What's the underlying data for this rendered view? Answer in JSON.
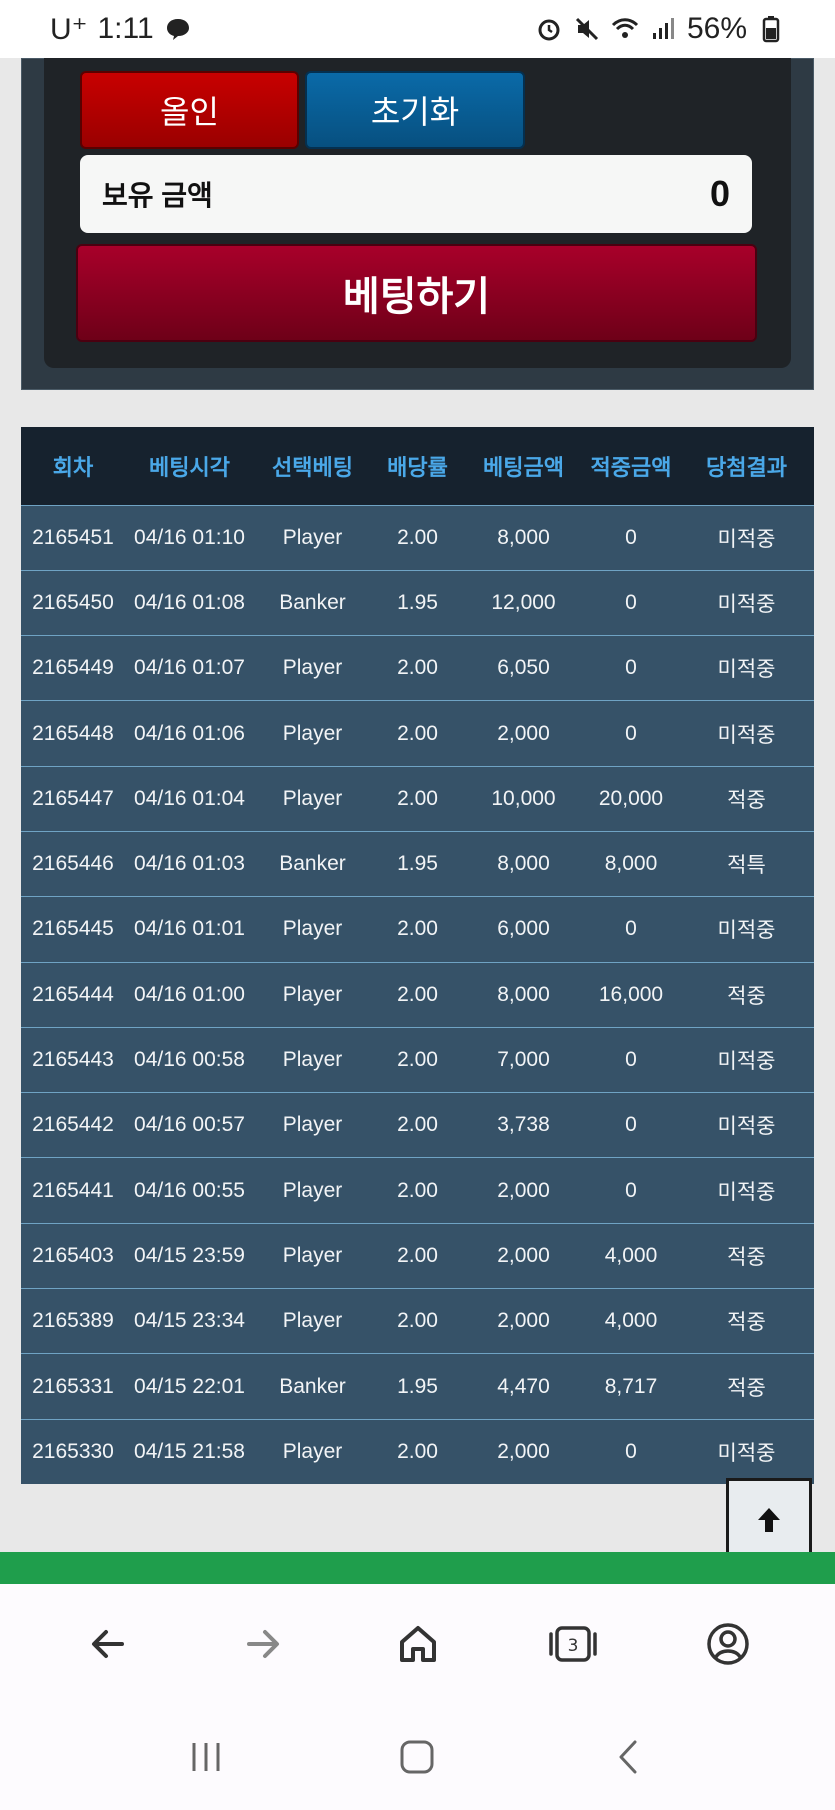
{
  "status_bar": {
    "carrier": "U⁺",
    "time": "1:11",
    "battery": "56%"
  },
  "controls": {
    "allin_label": "올인",
    "reset_label": "초기화",
    "balance_label": "보유 금액",
    "balance_value": "0",
    "bet_label": "베팅하기"
  },
  "table": {
    "headers": [
      "회차",
      "베팅시각",
      "선택베팅",
      "배당률",
      "베팅금액",
      "적중금액",
      "당첨결과"
    ],
    "rows": [
      [
        "2165451",
        "04/16 01:10",
        "Player",
        "2.00",
        "8,000",
        "0",
        "미적중"
      ],
      [
        "2165450",
        "04/16 01:08",
        "Banker",
        "1.95",
        "12,000",
        "0",
        "미적중"
      ],
      [
        "2165449",
        "04/16 01:07",
        "Player",
        "2.00",
        "6,050",
        "0",
        "미적중"
      ],
      [
        "2165448",
        "04/16 01:06",
        "Player",
        "2.00",
        "2,000",
        "0",
        "미적중"
      ],
      [
        "2165447",
        "04/16 01:04",
        "Player",
        "2.00",
        "10,000",
        "20,000",
        "적중"
      ],
      [
        "2165446",
        "04/16 01:03",
        "Banker",
        "1.95",
        "8,000",
        "8,000",
        "적특"
      ],
      [
        "2165445",
        "04/16 01:01",
        "Player",
        "2.00",
        "6,000",
        "0",
        "미적중"
      ],
      [
        "2165444",
        "04/16 01:00",
        "Player",
        "2.00",
        "8,000",
        "16,000",
        "적중"
      ],
      [
        "2165443",
        "04/16 00:58",
        "Player",
        "2.00",
        "7,000",
        "0",
        "미적중"
      ],
      [
        "2165442",
        "04/16 00:57",
        "Player",
        "2.00",
        "3,738",
        "0",
        "미적중"
      ],
      [
        "2165441",
        "04/16 00:55",
        "Player",
        "2.00",
        "2,000",
        "0",
        "미적중"
      ],
      [
        "2165403",
        "04/15 23:59",
        "Player",
        "2.00",
        "2,000",
        "4,000",
        "적중"
      ],
      [
        "2165389",
        "04/15 23:34",
        "Player",
        "2.00",
        "2,000",
        "4,000",
        "적중"
      ],
      [
        "2165331",
        "04/15 22:01",
        "Banker",
        "1.95",
        "4,470",
        "8,717",
        "적중"
      ],
      [
        "2165330",
        "04/15 21:58",
        "Player",
        "2.00",
        "2,000",
        "0",
        "미적중"
      ]
    ]
  },
  "browser_nav": {
    "tab_count": "3"
  },
  "colors": {
    "hit": "#e3a92d",
    "miss": "#d22020",
    "header_text": "#4aa8e8"
  }
}
